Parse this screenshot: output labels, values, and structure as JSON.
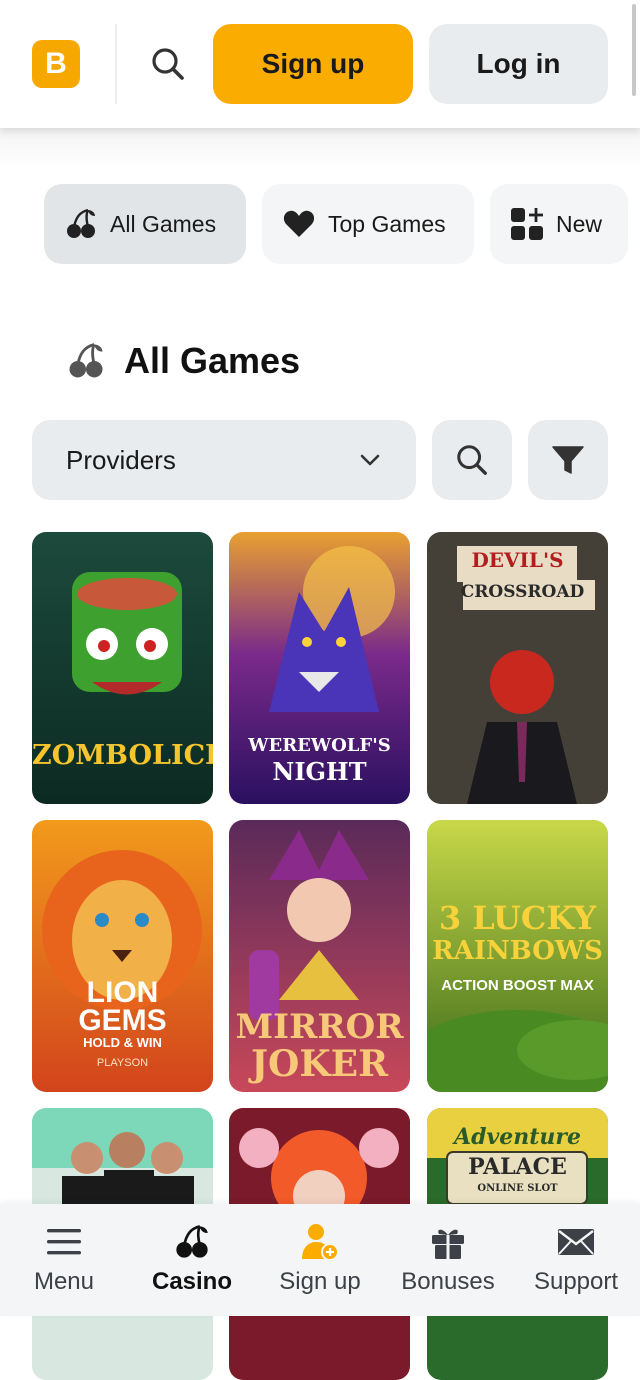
{
  "header": {
    "logo_letter": "B",
    "signup_label": "Sign up",
    "login_label": "Log in"
  },
  "categories": [
    {
      "label": "All Games",
      "icon": "cherry-icon",
      "active": true
    },
    {
      "label": "Top Games",
      "icon": "heart-icon",
      "active": false
    },
    {
      "label": "New",
      "icon": "grid-plus-icon",
      "active": false
    }
  ],
  "section": {
    "title": "All Games",
    "icon": "cherry-icon"
  },
  "filters": {
    "providers_label": "Providers",
    "search_icon": "search-icon",
    "filter_icon": "filter-icon"
  },
  "games": [
    {
      "title_lines": [
        "ZOMBOLICE"
      ],
      "colors": [
        "#1c4a3c",
        "#3ea02e"
      ]
    },
    {
      "title_lines": [
        "WEREWOLF'S",
        "NIGHT"
      ],
      "colors": [
        "#e8a030",
        "#3c1a7a"
      ]
    },
    {
      "title_lines": [
        "DEVIL'S",
        "CROSSROAD"
      ],
      "colors": [
        "#2a2a2a",
        "#5a5248"
      ]
    },
    {
      "title_lines": [
        "LION",
        "GEMS",
        "HOLD & WIN",
        "PLAYSON"
      ],
      "colors": [
        "#f29a1c",
        "#d2441c"
      ]
    },
    {
      "title_lines": [
        "MIRROR",
        "JOKER"
      ],
      "colors": [
        "#6a2a6a",
        "#b8485a"
      ]
    },
    {
      "title_lines": [
        "3 LUCKY",
        "RAINBOWS",
        "ACTION BOOST MAX"
      ],
      "colors": [
        "#c8d848",
        "#4a7a22"
      ]
    },
    {
      "title_lines": [],
      "colors": [
        "#1c3a2a",
        "#20c890"
      ]
    },
    {
      "title_lines": [],
      "colors": [
        "#7a1a2a",
        "#f25a2a"
      ]
    },
    {
      "title_lines": [
        "Adventure",
        "PALACE",
        "ONLINE SLOT"
      ],
      "colors": [
        "#e8d040",
        "#2a6a2a"
      ]
    }
  ],
  "bottom_nav": [
    {
      "label": "Menu",
      "icon": "hamburger-icon",
      "active": false
    },
    {
      "label": "Casino",
      "icon": "cherry-icon",
      "active": true
    },
    {
      "label": "Sign up",
      "icon": "add-user-icon",
      "active": false
    },
    {
      "label": "Bonuses",
      "icon": "gift-icon",
      "active": false
    },
    {
      "label": "Support",
      "icon": "mail-icon",
      "active": false
    }
  ],
  "colors": {
    "accent": "#fbac00",
    "pill_active": "#e2e5e8",
    "pill_inactive": "#f4f5f6",
    "control_bg": "#e9ecef"
  }
}
